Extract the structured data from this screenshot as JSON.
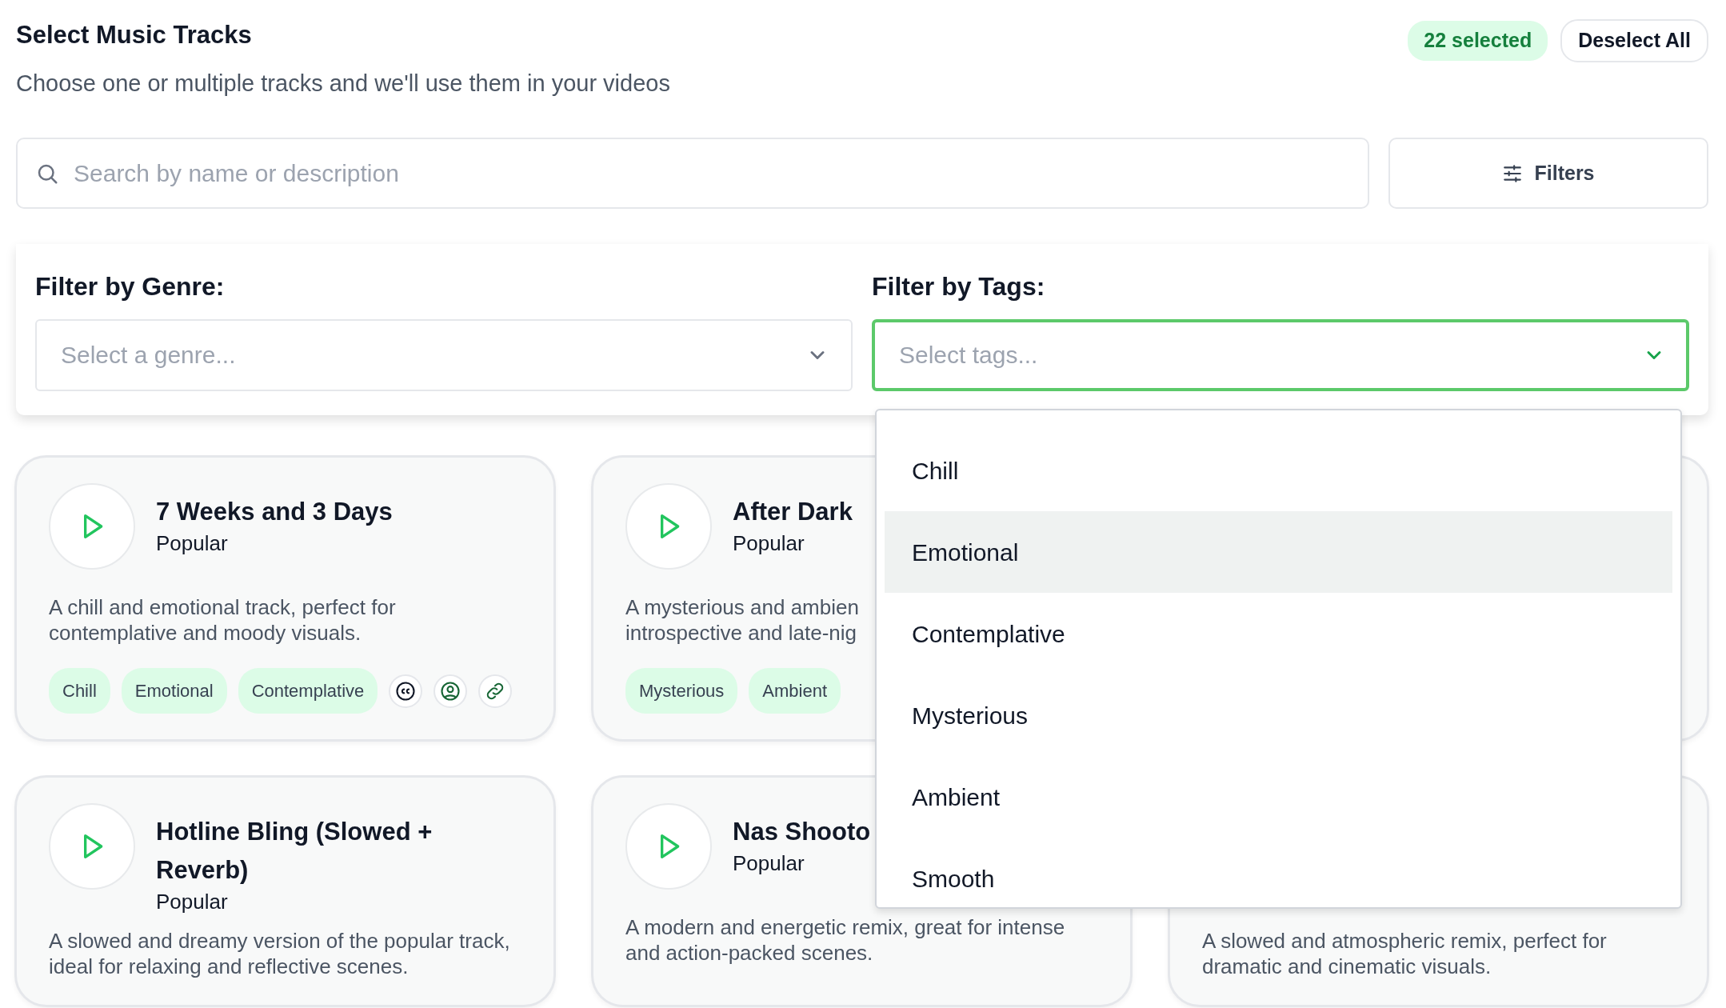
{
  "header": {
    "title": "Select Music Tracks",
    "subtitle": "Choose one or multiple tracks and we'll use them in your videos",
    "selected_badge": "22 selected",
    "deselect_button": "Deselect All"
  },
  "search": {
    "placeholder": "Search by name or description"
  },
  "filters_button": "Filters",
  "filter_panel": {
    "genre": {
      "label": "Filter by Genre:",
      "placeholder": "Select a genre...",
      "focused": false
    },
    "tags": {
      "label": "Filter by Tags:",
      "placeholder": "Select tags...",
      "focused": true
    }
  },
  "tag_dropdown": {
    "options": [
      {
        "label": "Chill",
        "selected": false
      },
      {
        "label": "Emotional",
        "selected": true
      },
      {
        "label": "Contemplative",
        "selected": false
      },
      {
        "label": "Mysterious",
        "selected": false
      },
      {
        "label": "Ambient",
        "selected": false
      },
      {
        "label": "Smooth",
        "selected": false
      }
    ]
  },
  "tracks": [
    {
      "kind": "track",
      "play": true,
      "title": "7 Weeks and 3 Days",
      "subtitle": "Popular",
      "description": "A chill and emotional track, perfect for contemplative and moody visuals.",
      "tags": [
        "Chill",
        "Emotional",
        "Contemplative"
      ],
      "actions": [
        {
          "kind": "captions"
        },
        {
          "kind": "artist"
        },
        {
          "kind": "link"
        }
      ]
    },
    {
      "kind": "track",
      "play": true,
      "title": "After Dark",
      "subtitle": "Popular",
      "description_lines": [
        "A mysterious and ambien",
        "introspective and late-nig"
      ],
      "tags": [
        "Mysterious",
        "Ambient"
      ]
    },
    {
      "kind": "covered"
    },
    {
      "kind": "track",
      "play": true,
      "title": "Hotline Bling (Slowed + Reverb)",
      "subtitle": "Popular",
      "description": "A slowed and dreamy version of the popular track, ideal for relaxing and reflective scenes."
    },
    {
      "kind": "track",
      "play": true,
      "title": "Nas Shooto",
      "subtitle": "Popular",
      "description": "A modern and energetic remix, great for intense and action-packed scenes."
    },
    {
      "kind": "track",
      "play": false,
      "description": "A slowed and atmospheric remix, perfect for dramatic and cinematic visuals."
    }
  ]
}
